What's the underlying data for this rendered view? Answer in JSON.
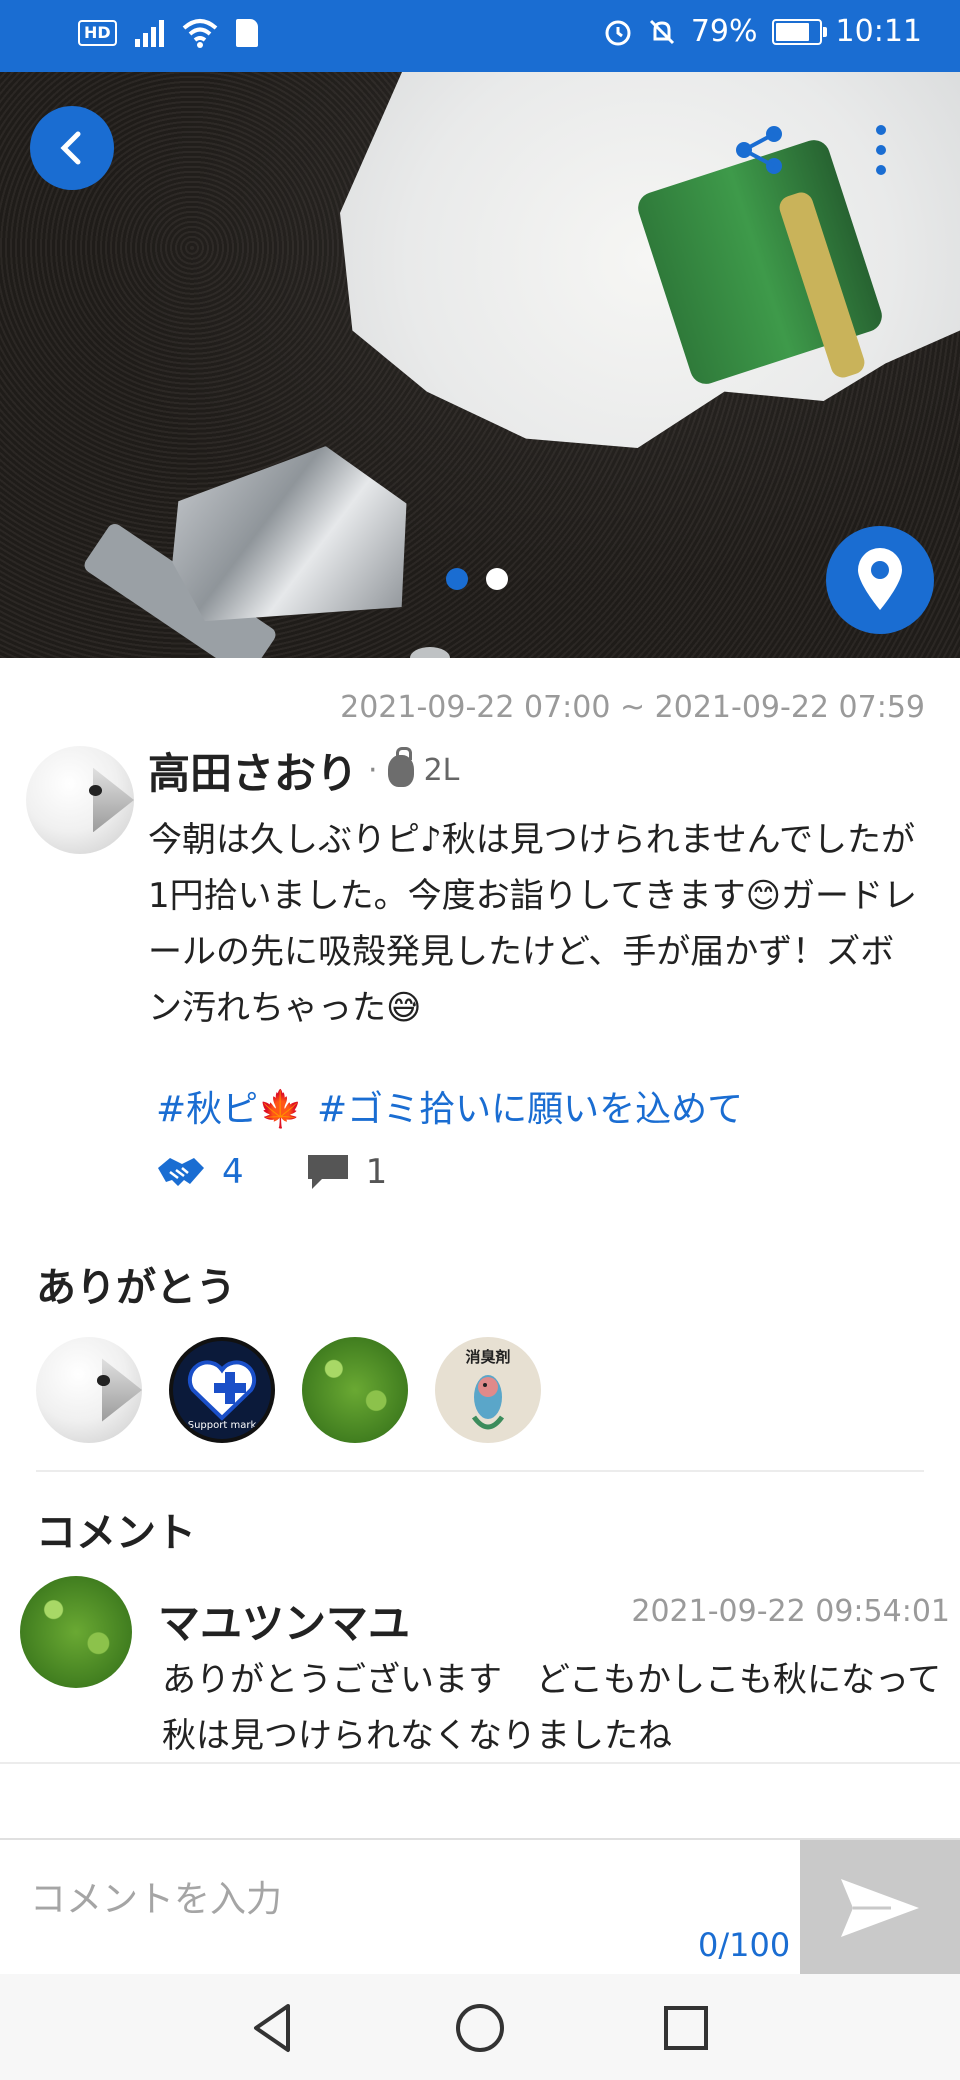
{
  "status_bar": {
    "hd_label": "HD",
    "battery_text": "79%",
    "battery_level": 0.79,
    "time": "10:11",
    "icons": [
      "hd-icon",
      "signal-icon",
      "wifi-icon",
      "sd-card-icon",
      "alarm-icon",
      "bell-off-icon",
      "battery-icon"
    ]
  },
  "hero": {
    "icons": [
      "back-icon",
      "share-icon",
      "more-vert-icon",
      "map-pin-icon"
    ],
    "image_count": 2,
    "active_index": 0
  },
  "post": {
    "time_range": "2021-09-22 07:00 ~ 2021-09-22 07:59",
    "author": {
      "name": "高田さおり",
      "separator": "·",
      "amount": "2L"
    },
    "body": "今朝は久しぶりピ♪秋は見つけられませんでしたが1円拾いました。今度お詣りしてきます😊ガードレールの先に吸殻発見したけど、手が届かず！ズボン汚れちゃった😅",
    "hashtags": [
      "#秋ピ🍁",
      "#ゴミ拾いに願いを込めて"
    ],
    "handshake_count": "4",
    "comment_count": "1"
  },
  "thanks": {
    "title": "ありがとう",
    "support_mark_text": "Support mark",
    "fish_badge_text": "消臭剤"
  },
  "comments": {
    "title": "コメント",
    "items": [
      {
        "name": "マユツンマユ",
        "time": "2021-09-22 09:54:01",
        "text": "ありがとうございます　どこもかしこも秋になって　秋は見つけられなくなりましたね"
      }
    ]
  },
  "input": {
    "placeholder": "コメントを入力",
    "counter": "0/100"
  },
  "colors": {
    "primary": "#1a6dd2",
    "muted_text": "#9a9a9a",
    "send_button_bg": "#c9c9c9"
  }
}
